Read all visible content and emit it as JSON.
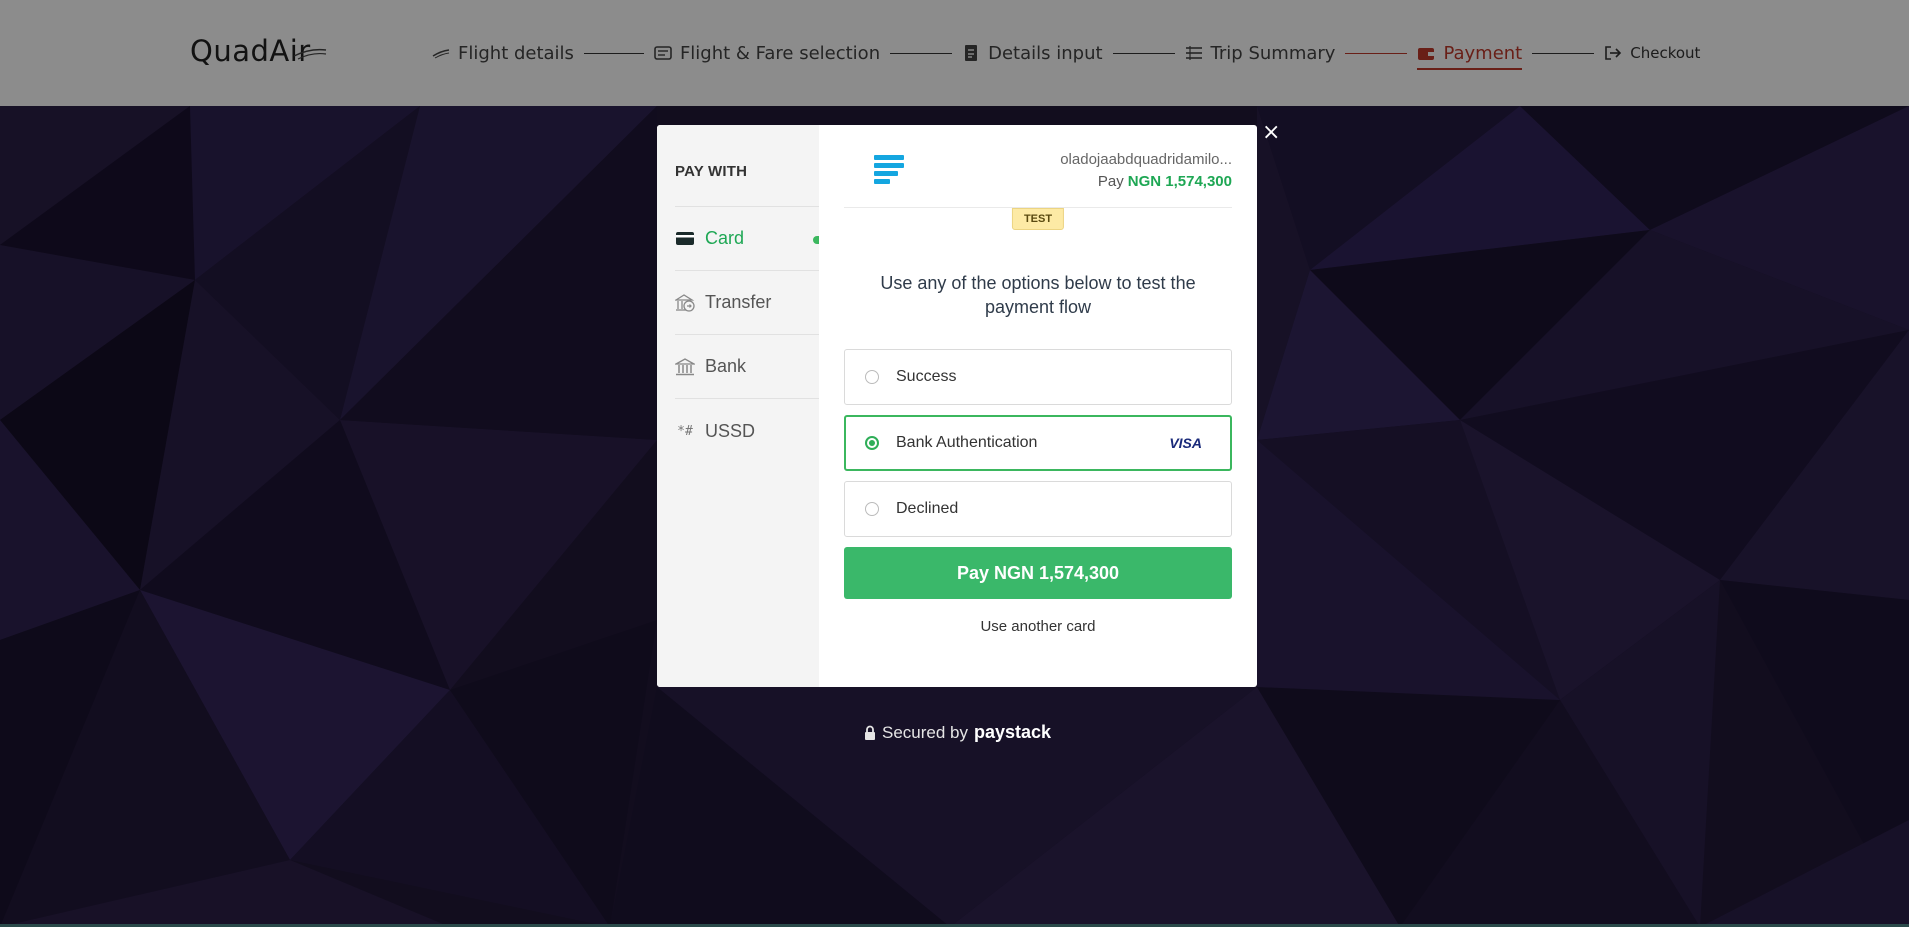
{
  "header": {
    "logo": "QuadAir",
    "steps": [
      {
        "label": "Flight details",
        "icon": "plane-icon"
      },
      {
        "label": "Flight & Fare selection",
        "icon": "ticket-icon"
      },
      {
        "label": "Details input",
        "icon": "document-icon"
      },
      {
        "label": "Trip Summary",
        "icon": "list-icon"
      },
      {
        "label": "Payment",
        "icon": "wallet-icon"
      },
      {
        "label": "Checkout",
        "icon": "sign-out-icon"
      }
    ],
    "active_step": "Payment",
    "colors": {
      "active": "#c0392b"
    }
  },
  "modal": {
    "sidebar": {
      "title": "PAY WITH",
      "items": [
        {
          "label": "Card",
          "icon": "card-icon",
          "active": true
        },
        {
          "label": "Transfer",
          "icon": "bank-transfer-icon",
          "active": false
        },
        {
          "label": "Bank",
          "icon": "bank-icon",
          "active": false
        },
        {
          "label": "USSD",
          "icon": "ussd-icon",
          "active": false
        }
      ]
    },
    "email": "oladojaabdquadridamilo...",
    "pay_prefix": "Pay",
    "pay_amount": "NGN 1,574,300",
    "test_badge": "TEST",
    "instruction": "Use any of the options below to test the payment flow",
    "options": [
      {
        "label": "Success",
        "selected": false
      },
      {
        "label": "Bank Authentication",
        "selected": true,
        "card_brand": "VISA"
      },
      {
        "label": "Declined",
        "selected": false
      }
    ],
    "pay_button": "Pay NGN 1,574,300",
    "another_card": "Use another card",
    "colors": {
      "accent": "#3ab86a"
    }
  },
  "footer": {
    "secured_by": "Secured by",
    "brand": "paystack"
  },
  "close_label": "×"
}
